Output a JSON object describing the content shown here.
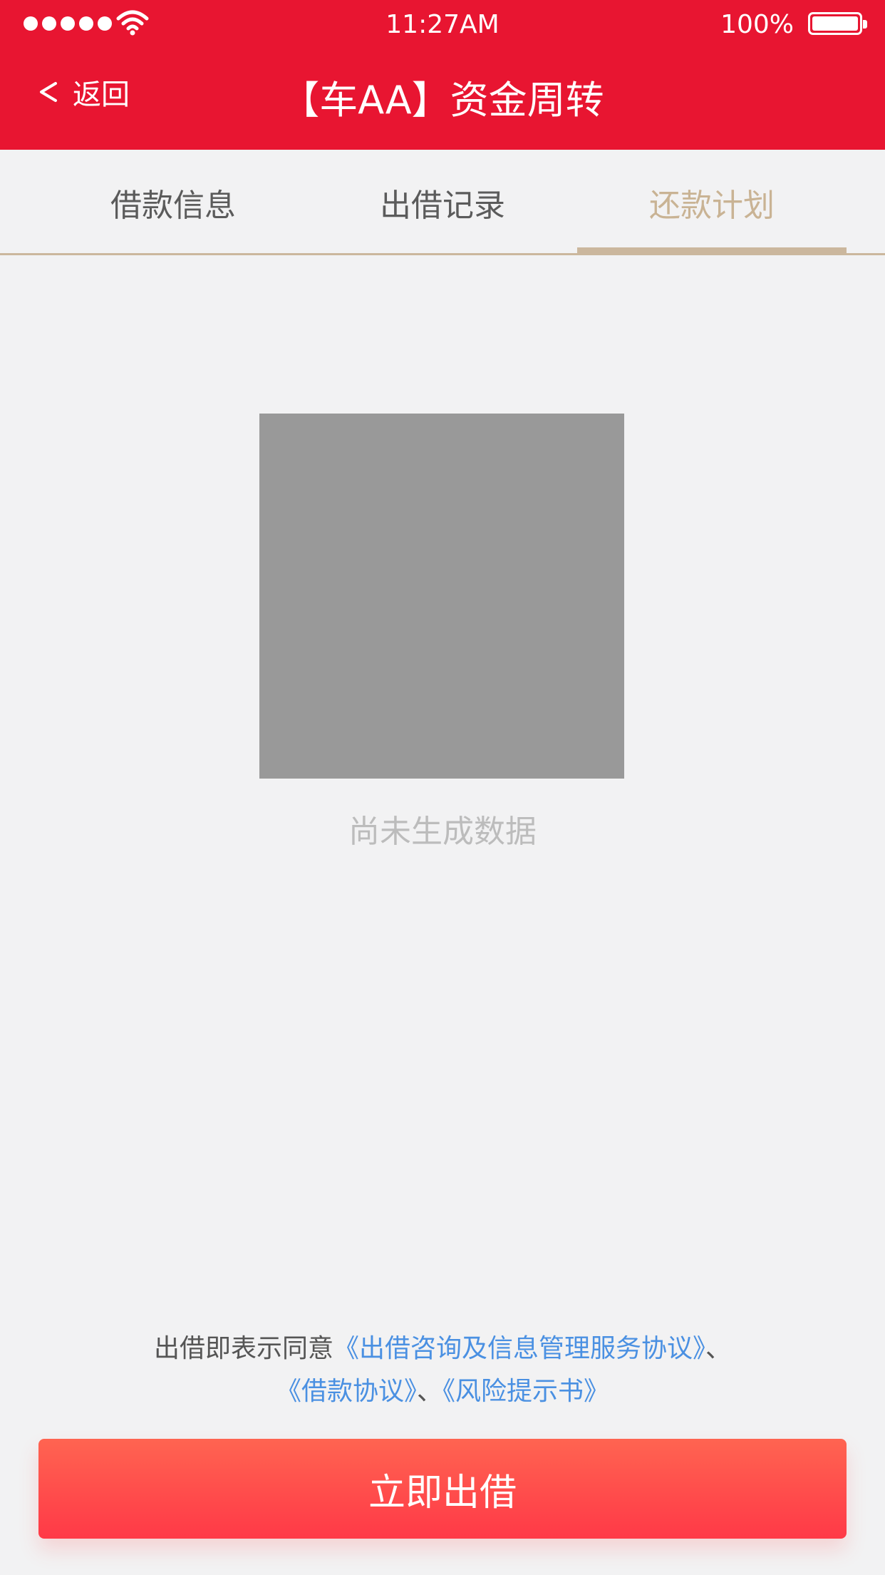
{
  "status_bar": {
    "time": "11:27AM",
    "battery": "100%",
    "signal_icon": "signal-dots-icon",
    "wifi_icon": "wifi-icon",
    "battery_icon": "battery-icon"
  },
  "nav": {
    "back_icon": "chevron-left-icon",
    "back_label": "返回",
    "title": "【车AA】资金周转"
  },
  "tabs": [
    {
      "label": "借款信息",
      "active": false
    },
    {
      "label": "出借记录",
      "active": false
    },
    {
      "label": "还款计划",
      "active": true
    }
  ],
  "empty_state": {
    "text": "尚未生成数据"
  },
  "agreement": {
    "prefix": "出借即表示同意",
    "link1": "《出借咨询及信息管理服务协议》",
    "sep1": "、",
    "link2": "《借款协议》",
    "sep2": "、",
    "link3": "《风险提示书》"
  },
  "action": {
    "invest_label": "立即出借"
  },
  "colors": {
    "header_red": "#e81531",
    "tab_active": "#c9b394",
    "link_blue": "#4a90e2",
    "button_top": "#ff6451",
    "button_bottom": "#ff3947"
  }
}
